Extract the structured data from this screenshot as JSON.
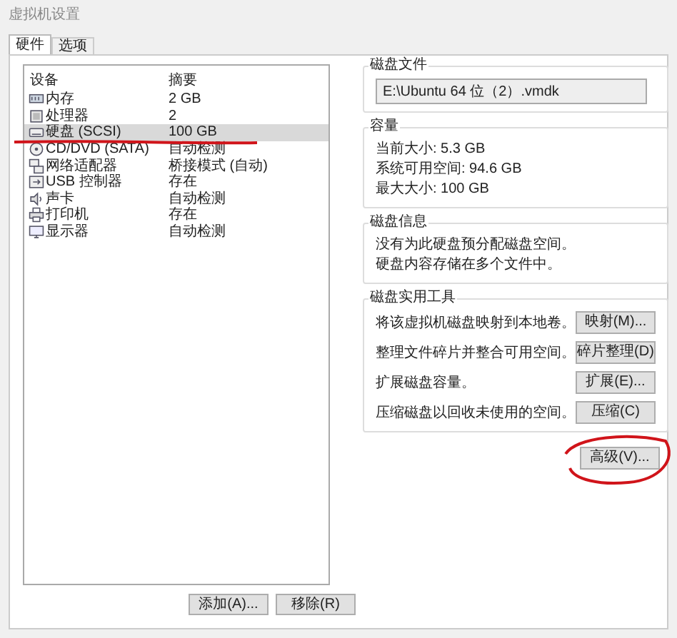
{
  "window": {
    "title": "虚拟机设置"
  },
  "tabs": [
    {
      "label": "硬件",
      "selected": true
    },
    {
      "label": "选项",
      "selected": false
    }
  ],
  "device_table": {
    "columns": [
      "设备",
      "摘要"
    ],
    "rows": [
      {
        "kind": "memory",
        "device": "内存",
        "summary": "2 GB",
        "selected": false
      },
      {
        "kind": "cpu",
        "device": "处理器",
        "summary": "2",
        "selected": false
      },
      {
        "kind": "disk",
        "device": "硬盘 (SCSI)",
        "summary": "100 GB",
        "selected": true
      },
      {
        "kind": "cd",
        "device": "CD/DVD (SATA)",
        "summary": "自动检测",
        "selected": false
      },
      {
        "kind": "network",
        "device": "网络适配器",
        "summary": "桥接模式 (自动)",
        "selected": false
      },
      {
        "kind": "usb",
        "device": "USB 控制器",
        "summary": "存在",
        "selected": false
      },
      {
        "kind": "sound",
        "device": "声卡",
        "summary": "自动检测",
        "selected": false
      },
      {
        "kind": "printer",
        "device": "打印机",
        "summary": "存在",
        "selected": false
      },
      {
        "kind": "display",
        "device": "显示器",
        "summary": "自动检测",
        "selected": false
      }
    ]
  },
  "device_buttons": [
    "添加(A)...",
    "移除(R)"
  ],
  "disk_file": {
    "title": "磁盘文件",
    "value": "E:\\Ubuntu 64 位（2）.vmdk"
  },
  "capacity": {
    "title": "容量",
    "lines": [
      "当前大小: 5.3 GB",
      "系统可用空间: 94.6 GB",
      "最大大小: 100 GB"
    ]
  },
  "disk_info": {
    "title": "磁盘信息",
    "lines": [
      "没有为此硬盘预分配磁盘空间。",
      "硬盘内容存储在多个文件中。"
    ]
  },
  "disk_utilities": {
    "title": "磁盘实用工具",
    "items": [
      {
        "text": "将该虚拟机磁盘映射到本地卷。",
        "button": "映射(M)..."
      },
      {
        "text": "整理文件碎片并整合可用空间。",
        "button": "碎片整理(D)"
      },
      {
        "text": "扩展磁盘容量。",
        "button": "扩展(E)..."
      },
      {
        "text": "压缩磁盘以回收未使用的空间。",
        "button": "压缩(C)"
      }
    ]
  },
  "advanced_button": "高级(V)..."
}
